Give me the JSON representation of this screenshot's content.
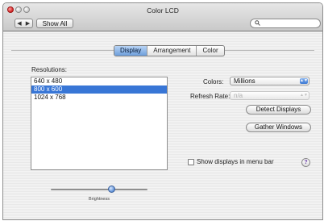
{
  "window": {
    "title": "Color LCD"
  },
  "toolbar": {
    "back_glyph": "◀",
    "forward_glyph": "▶",
    "show_all_label": "Show All",
    "search_placeholder": "",
    "search_icon_glyph": "🔍"
  },
  "tabs": [
    {
      "label": "Display",
      "active": true
    },
    {
      "label": "Arrangement",
      "active": false
    },
    {
      "label": "Color",
      "active": false
    }
  ],
  "resolutions": {
    "label": "Resolutions:",
    "items": [
      {
        "label": "640 x 480",
        "selected": false
      },
      {
        "label": "800 x 600",
        "selected": true
      },
      {
        "label": "1024 x 768",
        "selected": false
      }
    ]
  },
  "colors": {
    "label": "Colors:",
    "value": "Millions"
  },
  "refresh_rate": {
    "label": "Refresh Rate:",
    "value": "n/a"
  },
  "buttons": {
    "detect_displays": "Detect Displays",
    "gather_windows": "Gather Windows"
  },
  "menu_bar_option": {
    "label": "Show displays in menu bar",
    "checked": false
  },
  "help_glyph": "?",
  "brightness": {
    "label": "Brightness",
    "level": 0.6
  },
  "colors_theme": {
    "selection": "#3876d6",
    "tab_active": "#6d9edb"
  }
}
